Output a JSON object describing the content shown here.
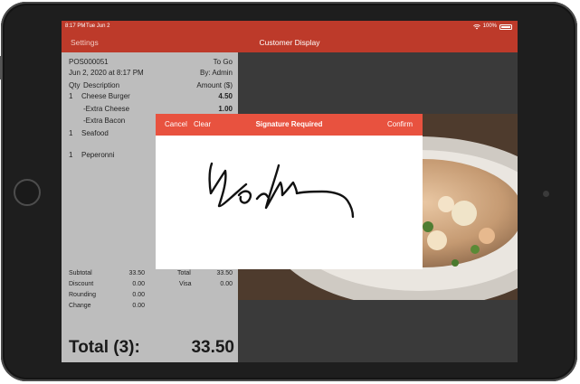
{
  "status_bar": {
    "time": "8:17 PM",
    "date": "Tue Jun 2",
    "battery_text": "100%"
  },
  "nav": {
    "settings_label": "Settings",
    "title": "Customer Display"
  },
  "receipt": {
    "order_no": "POS000051",
    "order_type": "To Go",
    "datetime": "Jun 2, 2020 at 8:17 PM",
    "staff": "By: Admin",
    "headers": {
      "qty": "Qty",
      "description": "Description",
      "amount": "Amount ($)"
    },
    "items": [
      {
        "qty": "1",
        "description": "Cheese Burger",
        "amount": "4.50"
      },
      {
        "qty": "",
        "description": "-Extra Cheese",
        "amount": "1.00"
      },
      {
        "qty": "",
        "description": "-Extra Bacon",
        "amount": ""
      },
      {
        "qty": "1",
        "description": "Seafood",
        "amount": ""
      },
      {
        "qty": "1",
        "description": "Peperonni",
        "amount": ""
      }
    ],
    "summary_left": [
      {
        "label": "Subtotal",
        "value": "33.50"
      },
      {
        "label": "Discount",
        "value": "0.00"
      },
      {
        "label": "Rounding",
        "value": "0.00"
      },
      {
        "label": "Change",
        "value": "0.00"
      }
    ],
    "summary_right": [
      {
        "label": "Total",
        "value": "33.50"
      },
      {
        "label": "Visa",
        "value": "0.00"
      }
    ],
    "total_label": "Total (3):",
    "total_value": "33.50"
  },
  "signature_dialog": {
    "cancel_label": "Cancel",
    "clear_label": "Clear",
    "title": "Signature Required",
    "confirm_label": "Confirm"
  },
  "colors": {
    "nav_bar": "#bd3a2a",
    "dialog_header": "#e8523f",
    "receipt_bg": "#bdbdbd",
    "screen_bg": "#3a3a3a"
  },
  "icons": [
    "wifi-icon",
    "battery-icon"
  ]
}
